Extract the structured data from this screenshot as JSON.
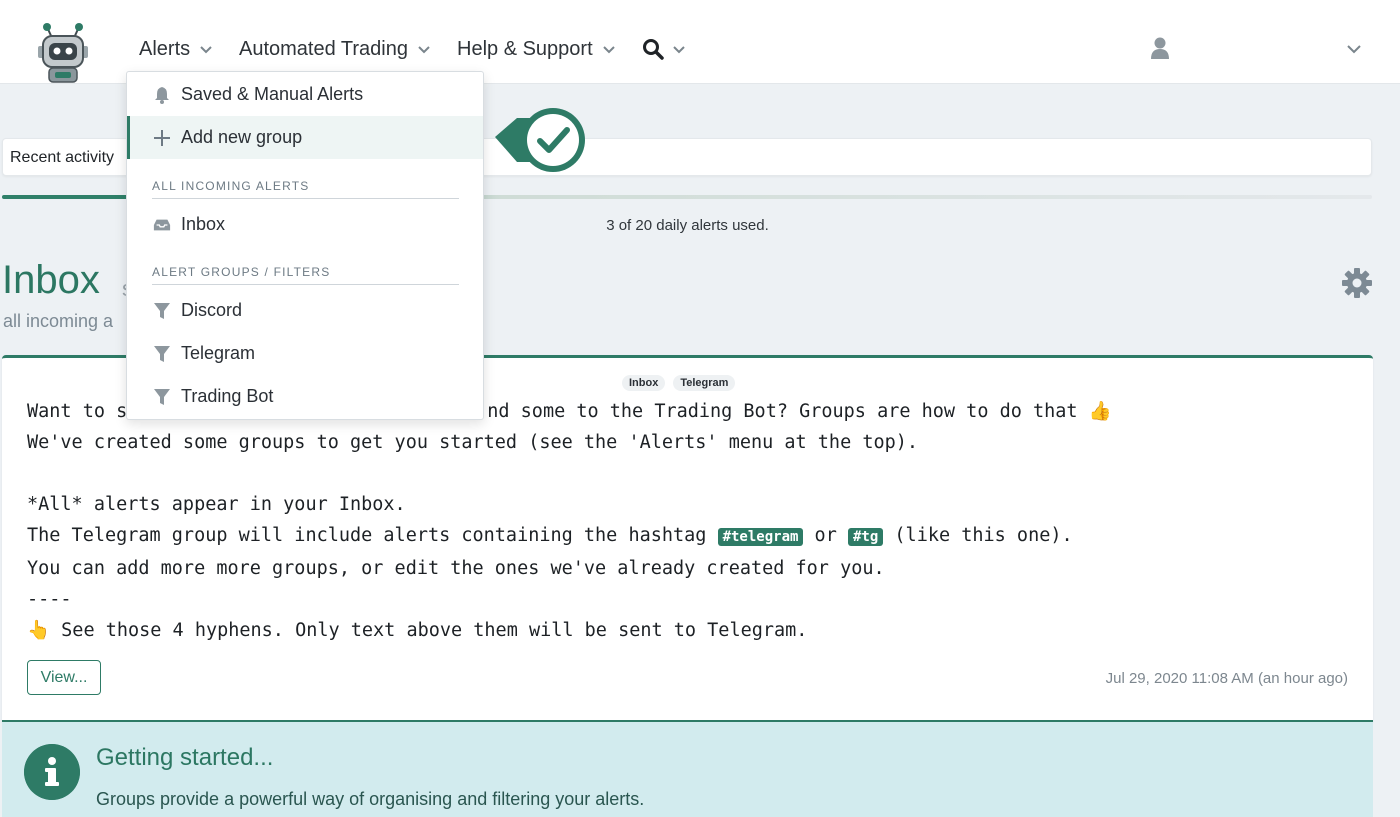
{
  "navbar": {
    "logo_name": "robot-logo",
    "menu": [
      {
        "label": "Alerts"
      },
      {
        "label": "Automated Trading"
      },
      {
        "label": "Help & Support"
      }
    ]
  },
  "dropdown": {
    "saved_label": "Saved & Manual Alerts",
    "add_group_label": "Add new group",
    "incoming_header": "ALL INCOMING ALERTS",
    "inbox_label": "Inbox",
    "groups_header": "ALERT GROUPS / FILTERS",
    "groups": [
      {
        "label": "Discord"
      },
      {
        "label": "Telegram"
      },
      {
        "label": "Trading Bot"
      }
    ]
  },
  "recent": {
    "label": "Recent activity",
    "daily_usage": "3 of 20 daily alerts used."
  },
  "inbox": {
    "title": "Inbox",
    "title_suffix": "s",
    "subtitle": "all incoming a"
  },
  "alert": {
    "tags": [
      "Inbox",
      "Telegram"
    ],
    "lines": [
      "Want to s",
      "nd some to the Trading Bot? Groups are how to do that 👍",
      "We've created some groups to get you started (see the 'Alerts' menu at the top).",
      "*All* alerts appear in your Inbox.",
      "The Telegram group will include alerts containing the hashtag ",
      "#telegram",
      " or ",
      "#tg",
      " (like this one).",
      "You can add more more groups, or edit the ones we've already created for you.",
      "----",
      "👆 See those 4 hyphens. Only text above them will be sent to Telegram."
    ],
    "view_label": "View...",
    "timestamp": "Jul 29, 2020 11:08 AM (an hour ago)"
  },
  "getting_started": {
    "title": "Getting started...",
    "text": "Groups provide a powerful way of organising and filtering your alerts."
  },
  "colors": {
    "brand": "#2e7b66",
    "info_bg": "#d2ebee"
  }
}
